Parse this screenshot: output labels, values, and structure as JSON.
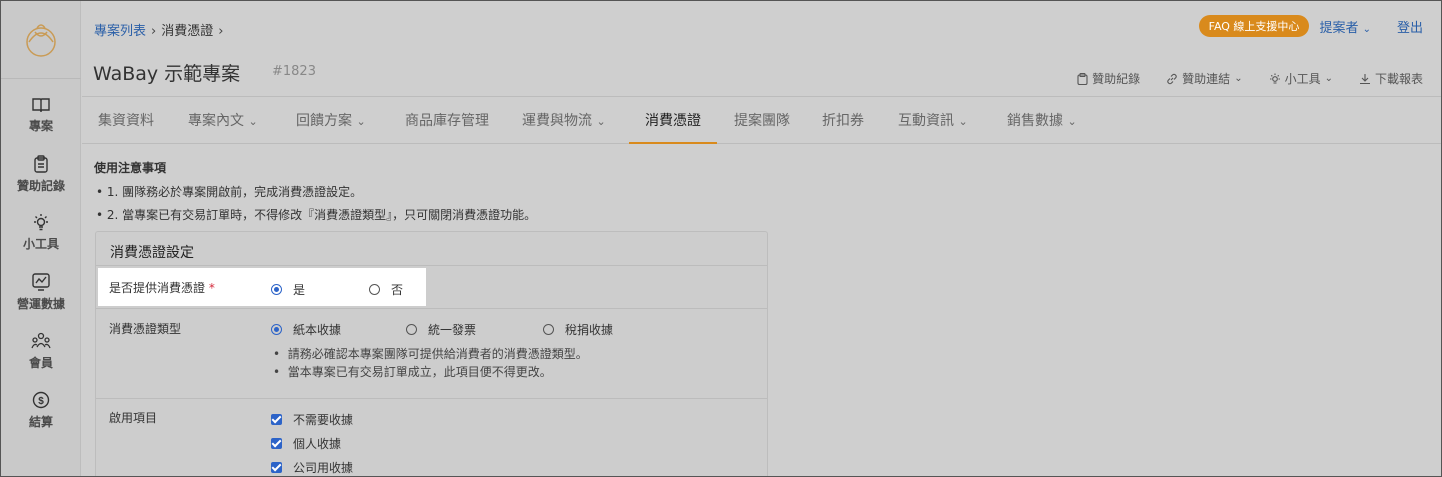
{
  "sidebar": {
    "items": [
      {
        "label": "專案",
        "icon": "book-icon"
      },
      {
        "label": "贊助記錄",
        "icon": "clipboard-icon"
      },
      {
        "label": "小工具",
        "icon": "lightbulb-icon"
      },
      {
        "label": "營運數據",
        "icon": "chart-icon"
      },
      {
        "label": "會員",
        "icon": "users-icon"
      },
      {
        "label": "結算",
        "icon": "dollar-icon"
      }
    ]
  },
  "header": {
    "breadcrumb": [
      "專案列表",
      "消費憑證"
    ],
    "title": "WaBay 示範專案",
    "project_id": "#1823",
    "faq_label": "FAQ 線上支援中心",
    "role_label": "提案者",
    "logout_label": "登出",
    "tools": [
      {
        "label": "贊助紀錄",
        "icon": "clipboard-icon"
      },
      {
        "label": "贊助連結",
        "icon": "link-icon"
      },
      {
        "label": "小工具",
        "icon": "lightbulb-icon"
      },
      {
        "label": "下載報表",
        "icon": "download-icon"
      }
    ]
  },
  "tabs": [
    {
      "label": "集資資料"
    },
    {
      "label": "專案內文"
    },
    {
      "label": "回饋方案"
    },
    {
      "label": "商品庫存管理"
    },
    {
      "label": "運費與物流"
    },
    {
      "label": "消費憑證"
    },
    {
      "label": "提案團隊"
    },
    {
      "label": "折扣券"
    },
    {
      "label": "互動資訊"
    },
    {
      "label": "銷售數據"
    }
  ],
  "notes": {
    "title": "使用注意事項",
    "items": [
      "1. 團隊務必於專案開啟前，完成消費憑證設定。",
      "2. 當專案已有交易訂單時，不得修改『消費憑證類型』，只可關閉消費憑證功能。"
    ]
  },
  "settings": {
    "title": "消費憑證設定",
    "provide": {
      "label": "是否提供消費憑證",
      "required_mark": "*",
      "options": [
        "是",
        "否"
      ],
      "selected": "是"
    },
    "type": {
      "label": "消費憑證類型",
      "options": [
        "紙本收據",
        "統一發票",
        "稅捐收據"
      ],
      "selected": "紙本收據",
      "hints": [
        "請務必確認本專案團隊可提供給消費者的消費憑證類型。",
        "當本專案已有交易訂單成立，此項目便不得更改。"
      ]
    },
    "enabled": {
      "label": "啟用項目",
      "items": [
        "不需要收據",
        "個人收據",
        "公司用收據"
      ]
    }
  },
  "colors": {
    "accent": "#d98a1c",
    "link": "#2a5fa8",
    "control": "#2c63c8",
    "required": "#d42a3c"
  }
}
